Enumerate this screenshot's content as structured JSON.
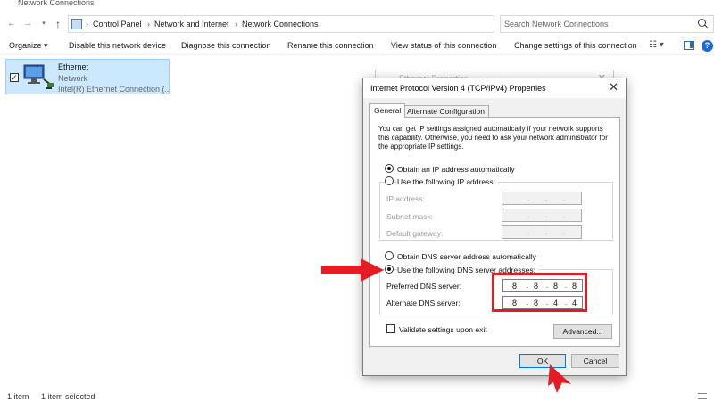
{
  "window": {
    "title": "Network Connections"
  },
  "address": {
    "breadcrumbs": [
      "Control Panel",
      "Network and Internet",
      "Network Connections"
    ],
    "search_placeholder": "Search Network Connections"
  },
  "commands": [
    "Organize",
    "Disable this network device",
    "Diagnose this connection",
    "Rename this connection",
    "View status of this connection",
    "Change settings of this connection"
  ],
  "icons": {
    "back": "back-arrow-icon",
    "forward": "forward-arrow-icon",
    "recent": "recent-locations-icon",
    "up": "up-arrow-icon",
    "refresh": "refresh-icon",
    "search": "search-icon",
    "help": "help-icon"
  },
  "connection": {
    "name": "Ethernet",
    "status": "Network",
    "device": "Intel(R) Ethernet Connection (..."
  },
  "status_bar": {
    "count": "1 item",
    "selected": "1 item selected"
  },
  "bg_dialog": {
    "title": "Ethernet Properties"
  },
  "dialog": {
    "title": "Internet Protocol Version 4 (TCP/IPv4) Properties",
    "tabs": [
      "General",
      "Alternate Configuration"
    ],
    "intro": "You can get IP settings assigned automatically if your network supports this capability. Otherwise, you need to ask your network administrator for the appropriate IP settings.",
    "ip_auto": "Obtain an IP address automatically",
    "ip_manual": "Use the following IP address:",
    "ip_fields": [
      "IP address:",
      "Subnet mask:",
      "Default gateway:"
    ],
    "dns_auto": "Obtain DNS server address automatically",
    "dns_manual": "Use the following DNS server addresses:",
    "preferred_label": "Preferred DNS server:",
    "preferred_octets": [
      "8",
      "8",
      "8",
      "8"
    ],
    "alternate_label": "Alternate DNS server:",
    "alternate_octets": [
      "8",
      "8",
      "4",
      "4"
    ],
    "validate": "Validate settings upon exit",
    "advanced": "Advanced...",
    "ok": "OK",
    "cancel": "Cancel"
  },
  "colors": {
    "highlight": "#e41d24",
    "selection": "#cce8ff",
    "accent": "#0078d7"
  }
}
